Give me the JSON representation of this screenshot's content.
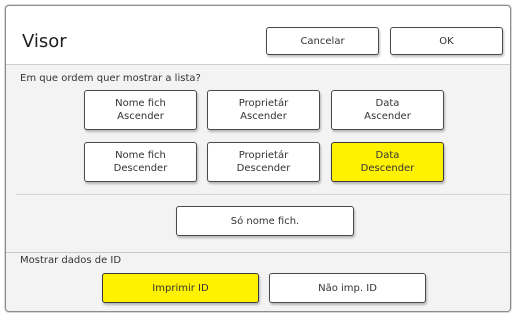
{
  "dialog": {
    "title": "Visor",
    "cancel_label": "Cancelar",
    "ok_label": "OK"
  },
  "order": {
    "prompt": "Em que ordem quer mostrar a lista?",
    "buttons": [
      {
        "line1": "Nome fich",
        "line2": "Ascender",
        "selected": false
      },
      {
        "line1": "Proprietár",
        "line2": "Ascender",
        "selected": false
      },
      {
        "line1": "Data",
        "line2": "Ascender",
        "selected": false
      },
      {
        "line1": "Nome fich",
        "line2": "Descender",
        "selected": false
      },
      {
        "line1": "Proprietár",
        "line2": "Descender",
        "selected": false
      },
      {
        "line1": "Data",
        "line2": "Descender",
        "selected": true
      }
    ],
    "filename_only_label": "Só nome fich."
  },
  "id_data": {
    "prompt": "Mostrar dados de ID",
    "print_id_label": "Imprimir ID",
    "print_id_selected": true,
    "no_print_id_label": "Não imp. ID"
  },
  "colors": {
    "selected": "#fff200",
    "section_bg": "#f3f3f3"
  }
}
